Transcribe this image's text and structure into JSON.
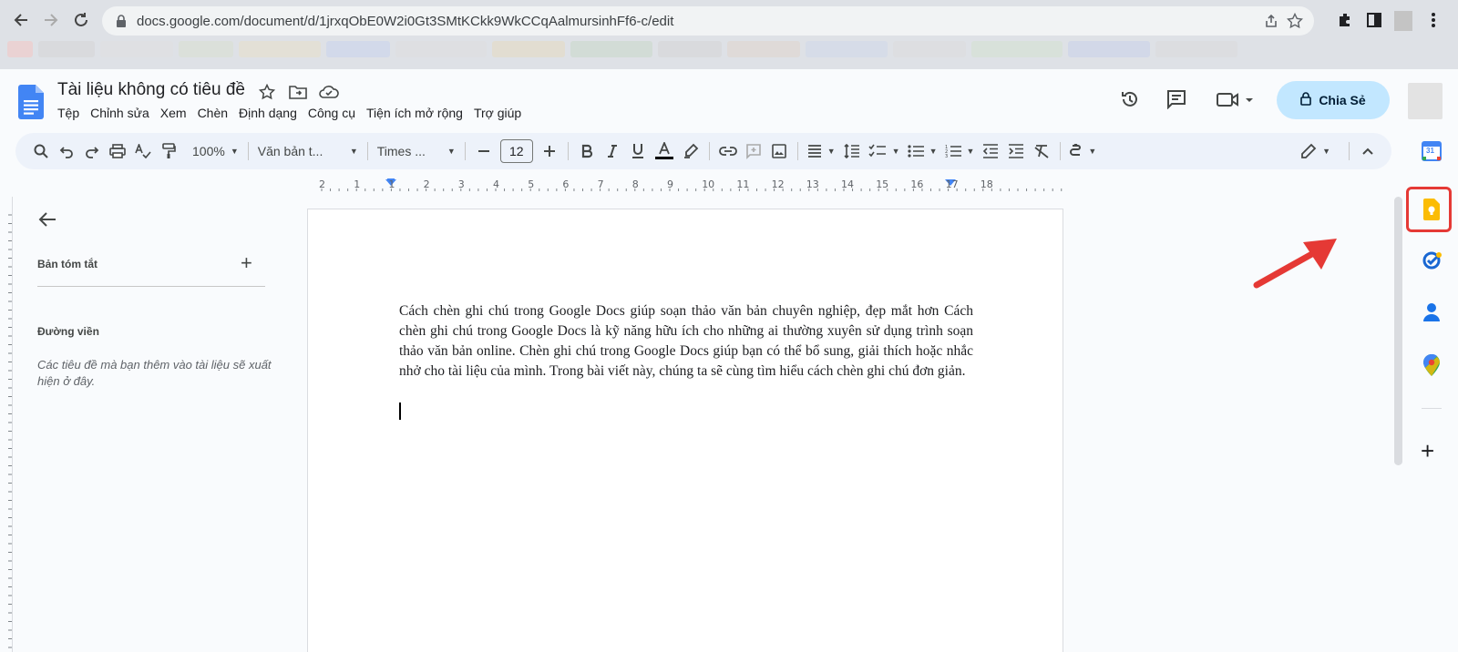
{
  "browser": {
    "url": "docs.google.com/document/d/1jrxqObE0W2i0Gt3SMtKCkk9WkCCqAalmursinhFf6-c/edit",
    "icons": [
      "back-icon",
      "forward-icon",
      "reload-icon",
      "lock-icon",
      "share-page-icon",
      "star-icon",
      "extensions-icon",
      "side-panel-icon",
      "menu-icon"
    ]
  },
  "docs": {
    "title": "Tài liệu không có tiêu đề",
    "menu": [
      "Tệp",
      "Chỉnh sửa",
      "Xem",
      "Chèn",
      "Định dạng",
      "Công cụ",
      "Tiện ích mở rộng",
      "Trợ giúp"
    ],
    "share_label": "Chia Sẻ"
  },
  "toolbar": {
    "zoom": "100%",
    "style": "Văn bản t...",
    "font": "Times ...",
    "font_size": "12"
  },
  "ruler": {
    "labels": [
      "2",
      "1",
      "1",
      "2",
      "3",
      "4",
      "5",
      "6",
      "7",
      "8",
      "9",
      "10",
      "11",
      "12",
      "13",
      "14",
      "15",
      "16",
      "17",
      "18"
    ]
  },
  "outline": {
    "summary_label": "Bản tóm tắt",
    "heading_label": "Đường viền",
    "hint": "Các tiêu đề mà bạn thêm vào tài liệu sẽ xuất hiện ở đây."
  },
  "document": {
    "paragraph": "Cách chèn ghi chú trong Google Docs giúp soạn thảo văn bản chuyên nghiệp, đẹp mắt hơn Cách chèn ghi chú trong Google Docs là kỹ năng hữu ích cho những ai thường xuyên sử dụng trình soạn thảo văn bản online. Chèn ghi chú trong Google Docs giúp bạn có thể bổ sung, giải thích hoặc nhắc nhở cho tài liệu của mình. Trong bài viết này, chúng ta sẽ cùng tìm hiểu cách chèn ghi chú đơn giản."
  },
  "side_panel": {
    "calendar_day": "31",
    "items": [
      "calendar-icon",
      "keep-icon",
      "tasks-icon",
      "contacts-icon",
      "maps-icon"
    ]
  },
  "colors": {
    "share_bg": "#c2e7ff",
    "toolbar_bg": "#edf2fa",
    "highlight": "#e53935",
    "docs_blue": "#4285f4",
    "keep_yellow": "#fbbc04"
  }
}
